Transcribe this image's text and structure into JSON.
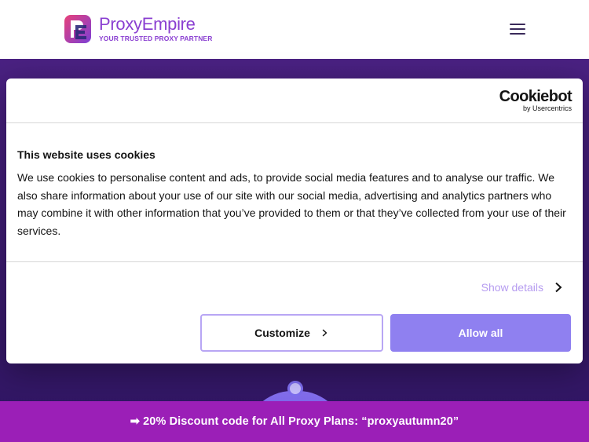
{
  "header": {
    "logo_name": "ProxyEmpire",
    "logo_tagline": "YOUR TRUSTED PROXY PARTNER",
    "menu_icon": "hamburger-icon"
  },
  "cookie_dialog": {
    "provider_logo": "Cookiebot",
    "provider_sub": "by Usercentrics",
    "title": "This website uses cookies",
    "body": "We use cookies to personalise content and ads, to provide social media features and to analyse our traffic. We also share information about your use of our site with our social media, advertising and analytics partners who may combine it with other information that you’ve provided to them or that they’ve collected from your use of their services.",
    "show_details_label": "Show details",
    "customize_label": "Customize",
    "allow_all_label": "Allow all"
  },
  "promo_bar": {
    "text": "➡ 20% Discount code for All Proxy Plans:  “proxyautumn20”"
  },
  "colors": {
    "brand": "#8a3fd1",
    "accent": "#8f80f0",
    "promo": "#9b1fb7"
  }
}
